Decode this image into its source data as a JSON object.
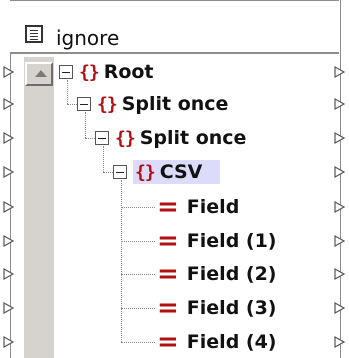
{
  "component": {
    "title": "ignore",
    "icon": "document-icon"
  },
  "tree": [
    {
      "label": "Root",
      "type": "element",
      "expanded": true
    },
    {
      "label": "Split once",
      "type": "element",
      "expanded": true
    },
    {
      "label": "Split once",
      "type": "element",
      "expanded": true
    },
    {
      "label": "CSV",
      "type": "element",
      "expanded": true,
      "selected": true
    },
    {
      "label": "Field",
      "type": "field"
    },
    {
      "label": "Field (1)",
      "type": "field"
    },
    {
      "label": "Field (2)",
      "type": "field"
    },
    {
      "label": "Field (3)",
      "type": "field"
    },
    {
      "label": "Field (4)",
      "type": "field"
    }
  ],
  "colors": {
    "brace": "#b21010",
    "selection": "#dcdcfa",
    "scrollbar": "#d6d3ce"
  }
}
